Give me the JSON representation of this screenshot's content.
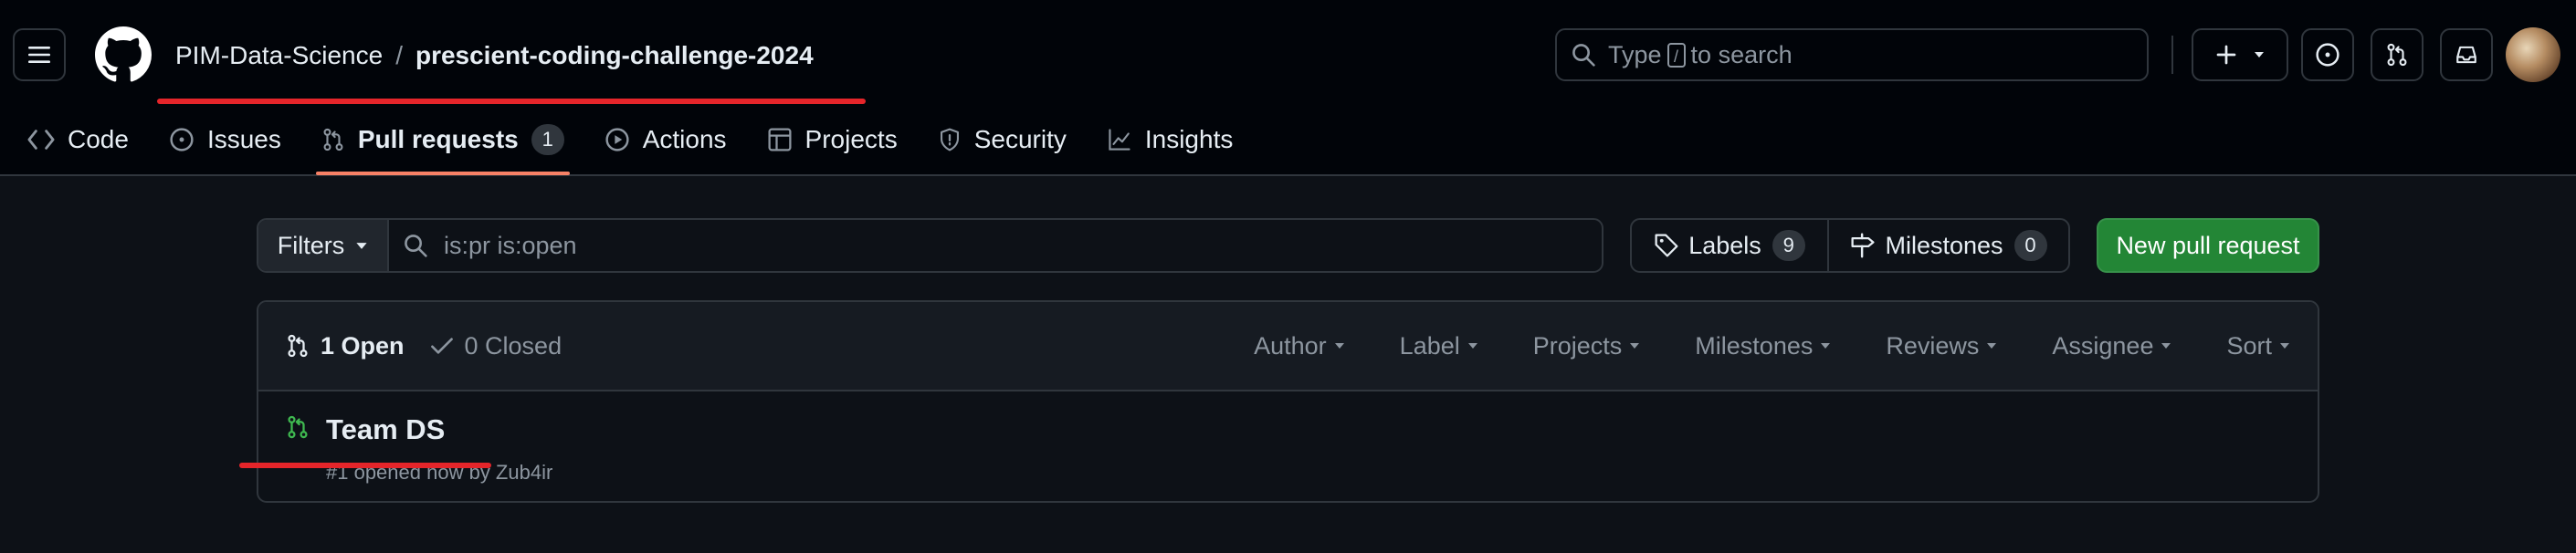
{
  "header": {
    "owner": "PIM-Data-Science",
    "separator": "/",
    "repo": "prescient-coding-challenge-2024",
    "search_prefix": "Type",
    "search_key": "/",
    "search_suffix": "to search"
  },
  "nav": {
    "tabs": [
      {
        "label": "Code",
        "icon": "code-icon"
      },
      {
        "label": "Issues",
        "icon": "issue-opened-icon"
      },
      {
        "label": "Pull requests",
        "icon": "git-pull-request-icon",
        "count": "1",
        "active": true
      },
      {
        "label": "Actions",
        "icon": "play-icon"
      },
      {
        "label": "Projects",
        "icon": "table-icon"
      },
      {
        "label": "Security",
        "icon": "shield-icon"
      },
      {
        "label": "Insights",
        "icon": "graph-icon"
      }
    ]
  },
  "filterbar": {
    "filters_label": "Filters",
    "query": "is:pr is:open",
    "labels_label": "Labels",
    "labels_count": "9",
    "milestones_label": "Milestones",
    "milestones_count": "0",
    "new_pr_label": "New pull request"
  },
  "list": {
    "open_label": "1 Open",
    "closed_label": "0 Closed",
    "filters": [
      "Author",
      "Label",
      "Projects",
      "Milestones",
      "Reviews",
      "Assignee",
      "Sort"
    ],
    "items": [
      {
        "title": "Team DS",
        "meta": "#1 opened now by Zub4ir"
      }
    ]
  },
  "colors": {
    "background": "#0d1117",
    "header_bg": "#010409",
    "primary_button": "#238636",
    "open_icon": "#3fb950",
    "active_tab_underline": "#f78166",
    "annotation_red": "#e5252a"
  }
}
